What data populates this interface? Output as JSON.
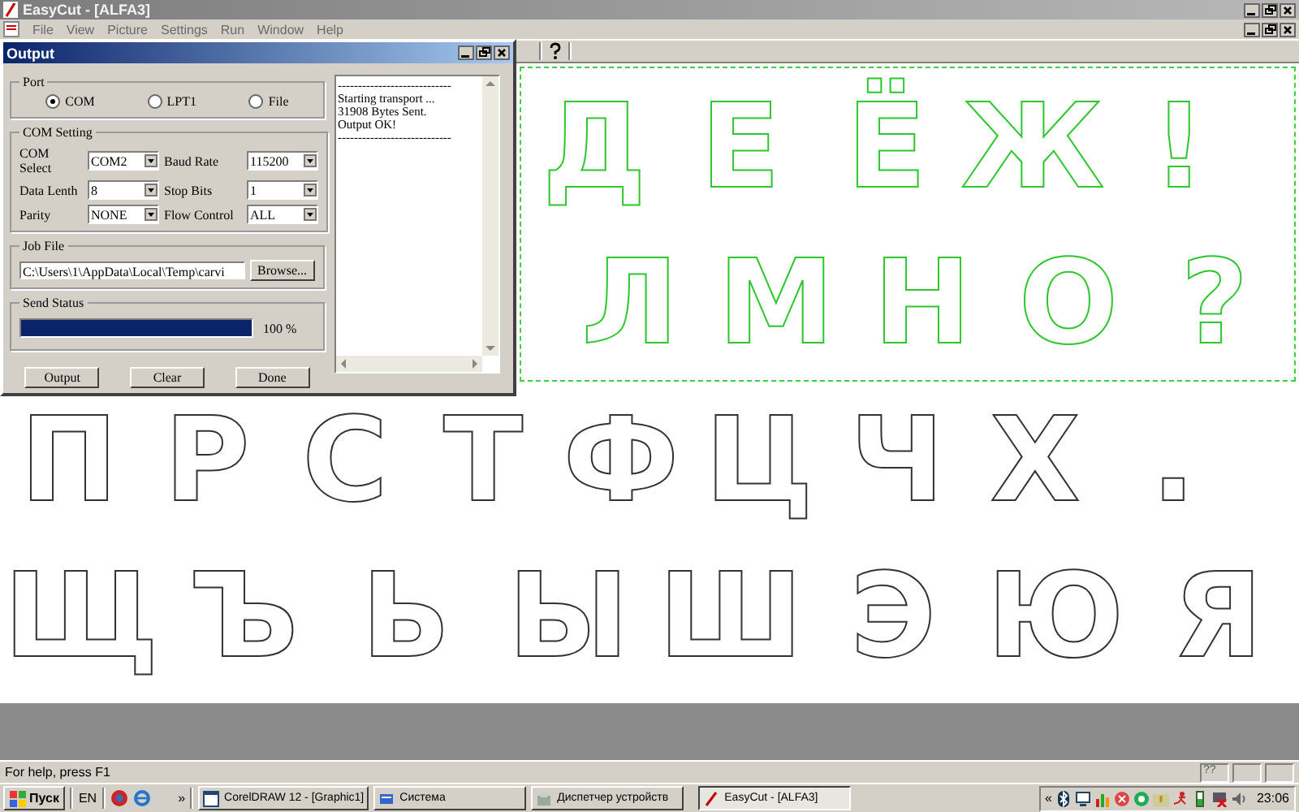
{
  "app_window": {
    "title": "EasyCut - [ALFA3]",
    "menu": [
      "File",
      "View",
      "Picture",
      "Settings",
      "Run",
      "Window",
      "Help"
    ]
  },
  "canvas": {
    "rows": [
      {
        "selected": true,
        "letters": [
          "Д",
          "Е",
          "Ё",
          "Ж",
          "!"
        ]
      },
      {
        "selected": true,
        "letters": [
          "Л",
          "М",
          "Н",
          "О",
          "?"
        ]
      },
      {
        "selected": false,
        "letters": [
          "П",
          "Р",
          "С",
          "Т",
          "Ф",
          "Ц",
          "Ч",
          "Х",
          "."
        ]
      },
      {
        "selected": false,
        "letters": [
          "Щ",
          "Ъ",
          "Ь",
          "Ы",
          "Ш",
          "Э",
          "Ю",
          "Я"
        ]
      }
    ]
  },
  "output_dialog": {
    "title": "Output",
    "port": {
      "label": "Port",
      "options": [
        {
          "label": "COM",
          "selected": true
        },
        {
          "label": "LPT1",
          "selected": false
        },
        {
          "label": "File",
          "selected": false
        }
      ]
    },
    "com_setting": {
      "label": "COM Setting",
      "fields": [
        {
          "label": "COM Select",
          "value": "COM2"
        },
        {
          "label": "Baud Rate",
          "value": "115200"
        },
        {
          "label": "Data Lenth",
          "value": "8"
        },
        {
          "label": "Stop Bits",
          "value": "1"
        },
        {
          "label": "Parity",
          "value": "NONE"
        },
        {
          "label": "Flow Control",
          "value": "ALL"
        }
      ]
    },
    "job_file": {
      "label": "Job File",
      "value": "C:\\Users\\1\\AppData\\Local\\Temp\\carvi",
      "button": "Browse..."
    },
    "send_status": {
      "label": "Send Status",
      "level": 1,
      "reading": "100 %"
    },
    "buttons": [
      "Output",
      "Clear",
      "Done"
    ],
    "log": [
      "----------------------------",
      "Starting transport ...",
      "31908 Bytes Sent.",
      "Output OK!",
      "----------------------------"
    ]
  },
  "status_bar": {
    "text": "For help, press F1",
    "indicator": "??"
  },
  "taskbar": {
    "start": "Пуск",
    "language": "EN",
    "more": "»",
    "tasks": [
      {
        "label": "CorelDRAW 12 - [Graphic1]",
        "selected": false
      },
      {
        "label": "Система",
        "selected": false
      },
      {
        "label": "Диспетчер устройств",
        "selected": false
      },
      {
        "label": "EasyCut - [ALFA3]",
        "selected": true
      }
    ],
    "tray_expand": "«",
    "clock": "23:06"
  }
}
